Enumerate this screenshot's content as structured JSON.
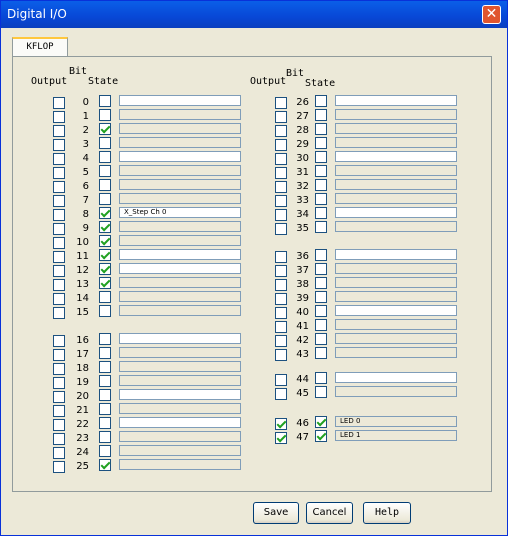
{
  "window": {
    "title": "Digital I/O",
    "close_glyph": "✕"
  },
  "tab": {
    "label": "KFLOP"
  },
  "headers": {
    "bit": "Bit",
    "output": "Output",
    "state": "State"
  },
  "buttons": {
    "save": "Save",
    "cancel": "Cancel",
    "help": "Help"
  },
  "bits": [
    {
      "bit": "0",
      "output": false,
      "state": false,
      "label": "",
      "white": true
    },
    {
      "bit": "1",
      "output": false,
      "state": false,
      "label": "",
      "white": false
    },
    {
      "bit": "2",
      "output": false,
      "state": true,
      "label": "",
      "white": false
    },
    {
      "bit": "3",
      "output": false,
      "state": false,
      "label": "",
      "white": false
    },
    {
      "bit": "4",
      "output": false,
      "state": false,
      "label": "",
      "white": true
    },
    {
      "bit": "5",
      "output": false,
      "state": false,
      "label": "",
      "white": false
    },
    {
      "bit": "6",
      "output": false,
      "state": false,
      "label": "",
      "white": false
    },
    {
      "bit": "7",
      "output": false,
      "state": false,
      "label": "",
      "white": false
    },
    {
      "bit": "8",
      "output": false,
      "state": true,
      "label": "X_Step Ch 0",
      "white": true
    },
    {
      "bit": "9",
      "output": false,
      "state": true,
      "label": "",
      "white": false
    },
    {
      "bit": "10",
      "output": false,
      "state": true,
      "label": "",
      "white": false
    },
    {
      "bit": "11",
      "output": false,
      "state": true,
      "label": "",
      "white": true
    },
    {
      "bit": "12",
      "output": false,
      "state": true,
      "label": "",
      "white": true
    },
    {
      "bit": "13",
      "output": false,
      "state": true,
      "label": "",
      "white": false
    },
    {
      "bit": "14",
      "output": false,
      "state": false,
      "label": "",
      "white": false
    },
    {
      "bit": "15",
      "output": false,
      "state": false,
      "label": "",
      "white": false
    },
    {
      "bit": "16",
      "output": false,
      "state": false,
      "label": "",
      "white": true
    },
    {
      "bit": "17",
      "output": false,
      "state": false,
      "label": "",
      "white": false
    },
    {
      "bit": "18",
      "output": false,
      "state": false,
      "label": "",
      "white": false
    },
    {
      "bit": "19",
      "output": false,
      "state": false,
      "label": "",
      "white": false
    },
    {
      "bit": "20",
      "output": false,
      "state": false,
      "label": "",
      "white": true
    },
    {
      "bit": "21",
      "output": false,
      "state": false,
      "label": "",
      "white": false
    },
    {
      "bit": "22",
      "output": false,
      "state": false,
      "label": "",
      "white": true
    },
    {
      "bit": "23",
      "output": false,
      "state": false,
      "label": "",
      "white": false
    },
    {
      "bit": "24",
      "output": false,
      "state": false,
      "label": "",
      "white": false
    },
    {
      "bit": "25",
      "output": false,
      "state": true,
      "label": "",
      "white": false
    },
    {
      "bit": "26",
      "output": false,
      "state": false,
      "label": "",
      "white": true
    },
    {
      "bit": "27",
      "output": false,
      "state": false,
      "label": "",
      "white": false
    },
    {
      "bit": "28",
      "output": false,
      "state": false,
      "label": "",
      "white": false
    },
    {
      "bit": "29",
      "output": false,
      "state": false,
      "label": "",
      "white": false
    },
    {
      "bit": "30",
      "output": false,
      "state": false,
      "label": "",
      "white": true
    },
    {
      "bit": "31",
      "output": false,
      "state": false,
      "label": "",
      "white": false
    },
    {
      "bit": "32",
      "output": false,
      "state": false,
      "label": "",
      "white": false
    },
    {
      "bit": "33",
      "output": false,
      "state": false,
      "label": "",
      "white": false
    },
    {
      "bit": "34",
      "output": false,
      "state": false,
      "label": "",
      "white": true
    },
    {
      "bit": "35",
      "output": false,
      "state": false,
      "label": "",
      "white": false
    },
    {
      "bit": "36",
      "output": false,
      "state": false,
      "label": "",
      "white": true
    },
    {
      "bit": "37",
      "output": false,
      "state": false,
      "label": "",
      "white": false
    },
    {
      "bit": "38",
      "output": false,
      "state": false,
      "label": "",
      "white": false
    },
    {
      "bit": "39",
      "output": false,
      "state": false,
      "label": "",
      "white": false
    },
    {
      "bit": "40",
      "output": false,
      "state": false,
      "label": "",
      "white": true
    },
    {
      "bit": "41",
      "output": false,
      "state": false,
      "label": "",
      "white": false
    },
    {
      "bit": "42",
      "output": false,
      "state": false,
      "label": "",
      "white": false
    },
    {
      "bit": "43",
      "output": false,
      "state": false,
      "label": "",
      "white": false
    },
    {
      "bit": "44",
      "output": false,
      "state": false,
      "label": "",
      "white": true
    },
    {
      "bit": "45",
      "output": false,
      "state": false,
      "label": "",
      "white": false
    },
    {
      "bit": "46",
      "output": true,
      "state": true,
      "label": "LED 0",
      "white": false
    },
    {
      "bit": "47",
      "output": true,
      "state": true,
      "label": "LED 1",
      "white": false
    }
  ],
  "colors": {
    "title_bar": "#0a5fe8",
    "dialog_bg": "#ece9d8",
    "check": "#21a121",
    "tab_accent": "#ffc73c"
  }
}
